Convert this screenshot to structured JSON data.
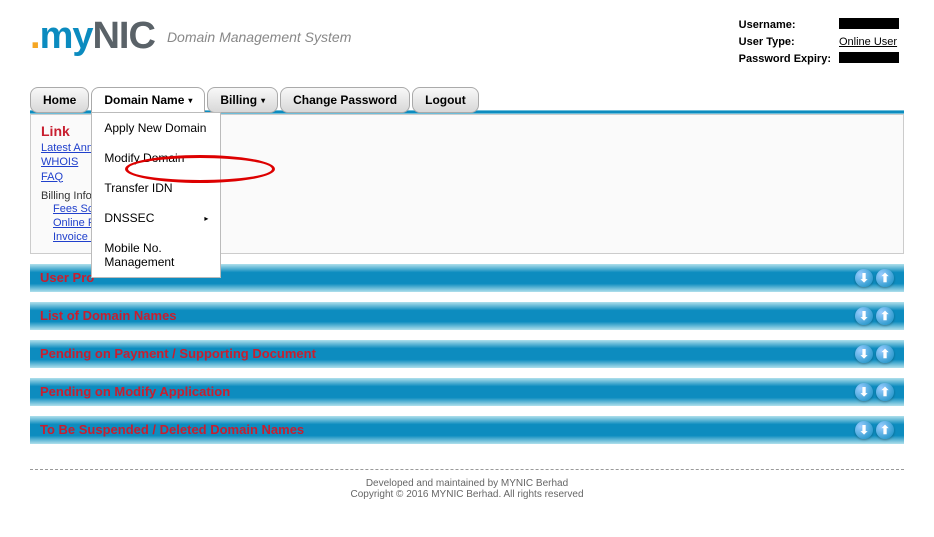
{
  "header": {
    "logo_tagline": "Domain Management System",
    "user_info": {
      "username_label": "Username:",
      "usertype_label": "User Type:",
      "usertype_value": "Online User",
      "expiry_label": "Password Expiry:"
    }
  },
  "menu": {
    "home": "Home",
    "domain_name": "Domain Name",
    "billing": "Billing",
    "change_password": "Change Password",
    "logout": "Logout"
  },
  "dropdown": {
    "apply": "Apply New Domain",
    "modify": "Modify Domain",
    "transfer": "Transfer IDN",
    "dnssec": "DNSSEC",
    "mobile": "Mobile No. Management"
  },
  "link_panel": {
    "title": "Link",
    "latest_ann": "Latest Ann",
    "whois": "WHOIS",
    "faq": "FAQ",
    "billing_label": "Billing Inform",
    "fees": "Fees Sch",
    "online_pay": "Online Pa",
    "invoice": "Invoice / "
  },
  "sections": {
    "user_profile": "User Pro",
    "list_domain": "List of Domain Names",
    "pending_payment": "Pending on Payment / Supporting Document",
    "pending_modify": "Pending on Modify Application",
    "suspended": "To Be Suspended / Deleted Domain Names"
  },
  "footer": {
    "line1": "Developed and maintained by MYNIC Berhad",
    "line2": "Copyright © 2016 MYNIC Berhad. All rights reserved"
  }
}
